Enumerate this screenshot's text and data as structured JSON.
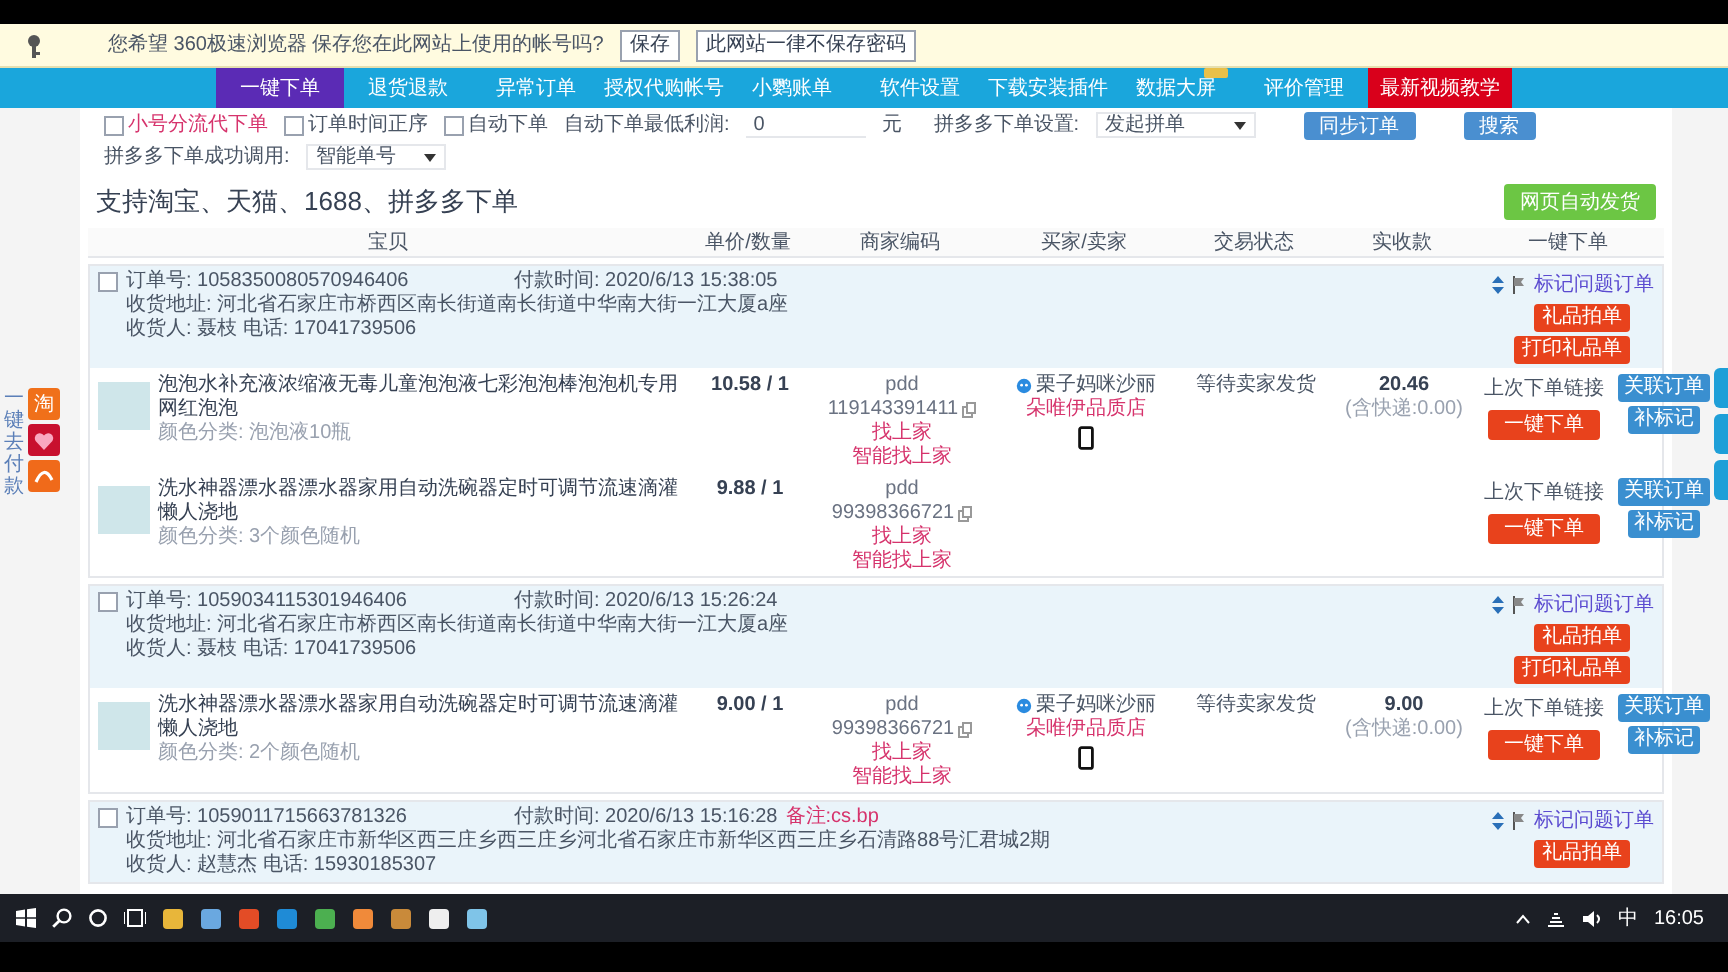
{
  "password_bar": {
    "message": "您希望 360极速浏览器 保存您在此网站上使用的帐号吗?",
    "buttons": [
      "保存",
      "此网站一律不保存密码"
    ]
  },
  "nav": [
    {
      "label": "一键下单",
      "selected": true,
      "kind": "normal"
    },
    {
      "label": "退货退款",
      "selected": false,
      "kind": "normal"
    },
    {
      "label": "异常订单",
      "selected": false,
      "kind": "normal"
    },
    {
      "label": "授权代购帐号",
      "selected": false,
      "kind": "normal"
    },
    {
      "label": "小鹦账单",
      "selected": false,
      "kind": "normal"
    },
    {
      "label": "软件设置",
      "selected": false,
      "kind": "normal"
    },
    {
      "label": "下载安装插件",
      "selected": false,
      "kind": "normal"
    },
    {
      "label": "数据大屏",
      "selected": false,
      "kind": "badged"
    },
    {
      "label": "评价管理",
      "selected": false,
      "kind": "normal"
    },
    {
      "label": "最新视频教学",
      "selected": false,
      "kind": "highlight"
    }
  ],
  "filters": {
    "checkboxes": [
      {
        "label": "小号分流代下单",
        "checked": false,
        "kind": "alert"
      },
      {
        "label": "订单时间正序",
        "checked": false,
        "kind": "plain"
      },
      {
        "label": "自动下单",
        "checked": false,
        "kind": "plain"
      }
    ],
    "min_profit": {
      "label": "自动下单最低利润:",
      "value": "0",
      "unit": "元"
    },
    "pdd_setting": {
      "label": "拼多多下单设置:",
      "value": "发起拼单"
    },
    "buttons": [
      "同步订单",
      "搜索"
    ],
    "pdd_success": {
      "label": "拼多多下单成功调用:",
      "value": "智能单号"
    }
  },
  "heading": "支持淘宝、天猫、1688、拼多多下单",
  "auto_ship_button": "网页自动发货",
  "columns": [
    "宝贝",
    "单价/数量",
    "商家编码",
    "买家/卖家",
    "交易状态",
    "实收款",
    "一键下单"
  ],
  "orders": [
    {
      "checked": false,
      "order_no": "订单号: 1058350080570946406",
      "pay_time": "付款时间: 2020/6/13 15:38:05",
      "address": "收货地址: 河北省石家庄市桥西区南长街道南长街道中华南大街一江大厦a座",
      "receiver": "收货人: 聂枝 电话: 17041739506",
      "flag_link": "标记问题订单",
      "action_buttons": [
        "礼品拍单",
        "打印礼品单"
      ],
      "buyer": "栗子妈咪沙丽",
      "seller": "朵唯伊品质店",
      "status": "等待卖家发货",
      "amount": "20.46",
      "shipping": "(含快递:0.00)",
      "items": [
        {
          "title": "泡泡水补充液浓缩液无毒儿童泡泡液七彩泡泡棒泡泡机专用网红泡泡",
          "sku": "颜色分类: 泡泡液10瓶",
          "price": "10.58 / 1",
          "platform": "pdd",
          "code": "119143391411",
          "links": [
            "找上家",
            "智能找上家"
          ],
          "last_link": "上次下单链接",
          "order_button": "一键下单",
          "side_buttons": [
            "关联订单",
            "补标记"
          ]
        },
        {
          "title": "洗水神器漂水器漂水器家用自动洗碗器定时可调节流速滴灌懒人浇地",
          "sku": "颜色分类: 3个颜色随机",
          "price": "9.88 / 1",
          "platform": "pdd",
          "code": "99398366721",
          "links": [
            "找上家",
            "智能找上家"
          ],
          "last_link": "上次下单链接",
          "order_button": "一键下单",
          "side_buttons": [
            "关联订单",
            "补标记"
          ]
        }
      ]
    },
    {
      "checked": false,
      "order_no": "订单号: 1059034115301946406",
      "pay_time": "付款时间: 2020/6/13 15:26:24",
      "address": "收货地址: 河北省石家庄市桥西区南长街道南长街道中华南大街一江大厦a座",
      "receiver": "收货人: 聂枝 电话: 17041739506",
      "flag_link": "标记问题订单",
      "action_buttons": [
        "礼品拍单",
        "打印礼品单"
      ],
      "buyer": "栗子妈咪沙丽",
      "seller": "朵唯伊品质店",
      "status": "等待卖家发货",
      "amount": "9.00",
      "shipping": "(含快递:0.00)",
      "items": [
        {
          "title": "洗水神器漂水器漂水器家用自动洗碗器定时可调节流速滴灌懒人浇地",
          "sku": "颜色分类: 2个颜色随机",
          "price": "9.00 / 1",
          "platform": "pdd",
          "code": "99398366721",
          "links": [
            "找上家",
            "智能找上家"
          ],
          "last_link": "上次下单链接",
          "order_button": "一键下单",
          "side_buttons": [
            "关联订单",
            "补标记"
          ]
        }
      ]
    },
    {
      "checked": false,
      "order_no": "订单号: 1059011715663781326",
      "pay_time": "付款时间: 2020/6/13 15:16:28",
      "note": "备注:cs.bp",
      "address": "收货地址: 河北省石家庄市新华区西三庄乡西三庄乡河北省石家庄市新华区西三庄乡石清路88号汇君城2期",
      "receiver": "收货人: 赵慧杰 电话: 15930185307",
      "flag_link": "标记问题订单",
      "action_buttons": [
        "礼品拍单"
      ]
    }
  ],
  "pay_widget": {
    "label": "一键去付款",
    "tile": "淘"
  },
  "taskbar": {
    "ime": "中",
    "clock": "16:05"
  }
}
